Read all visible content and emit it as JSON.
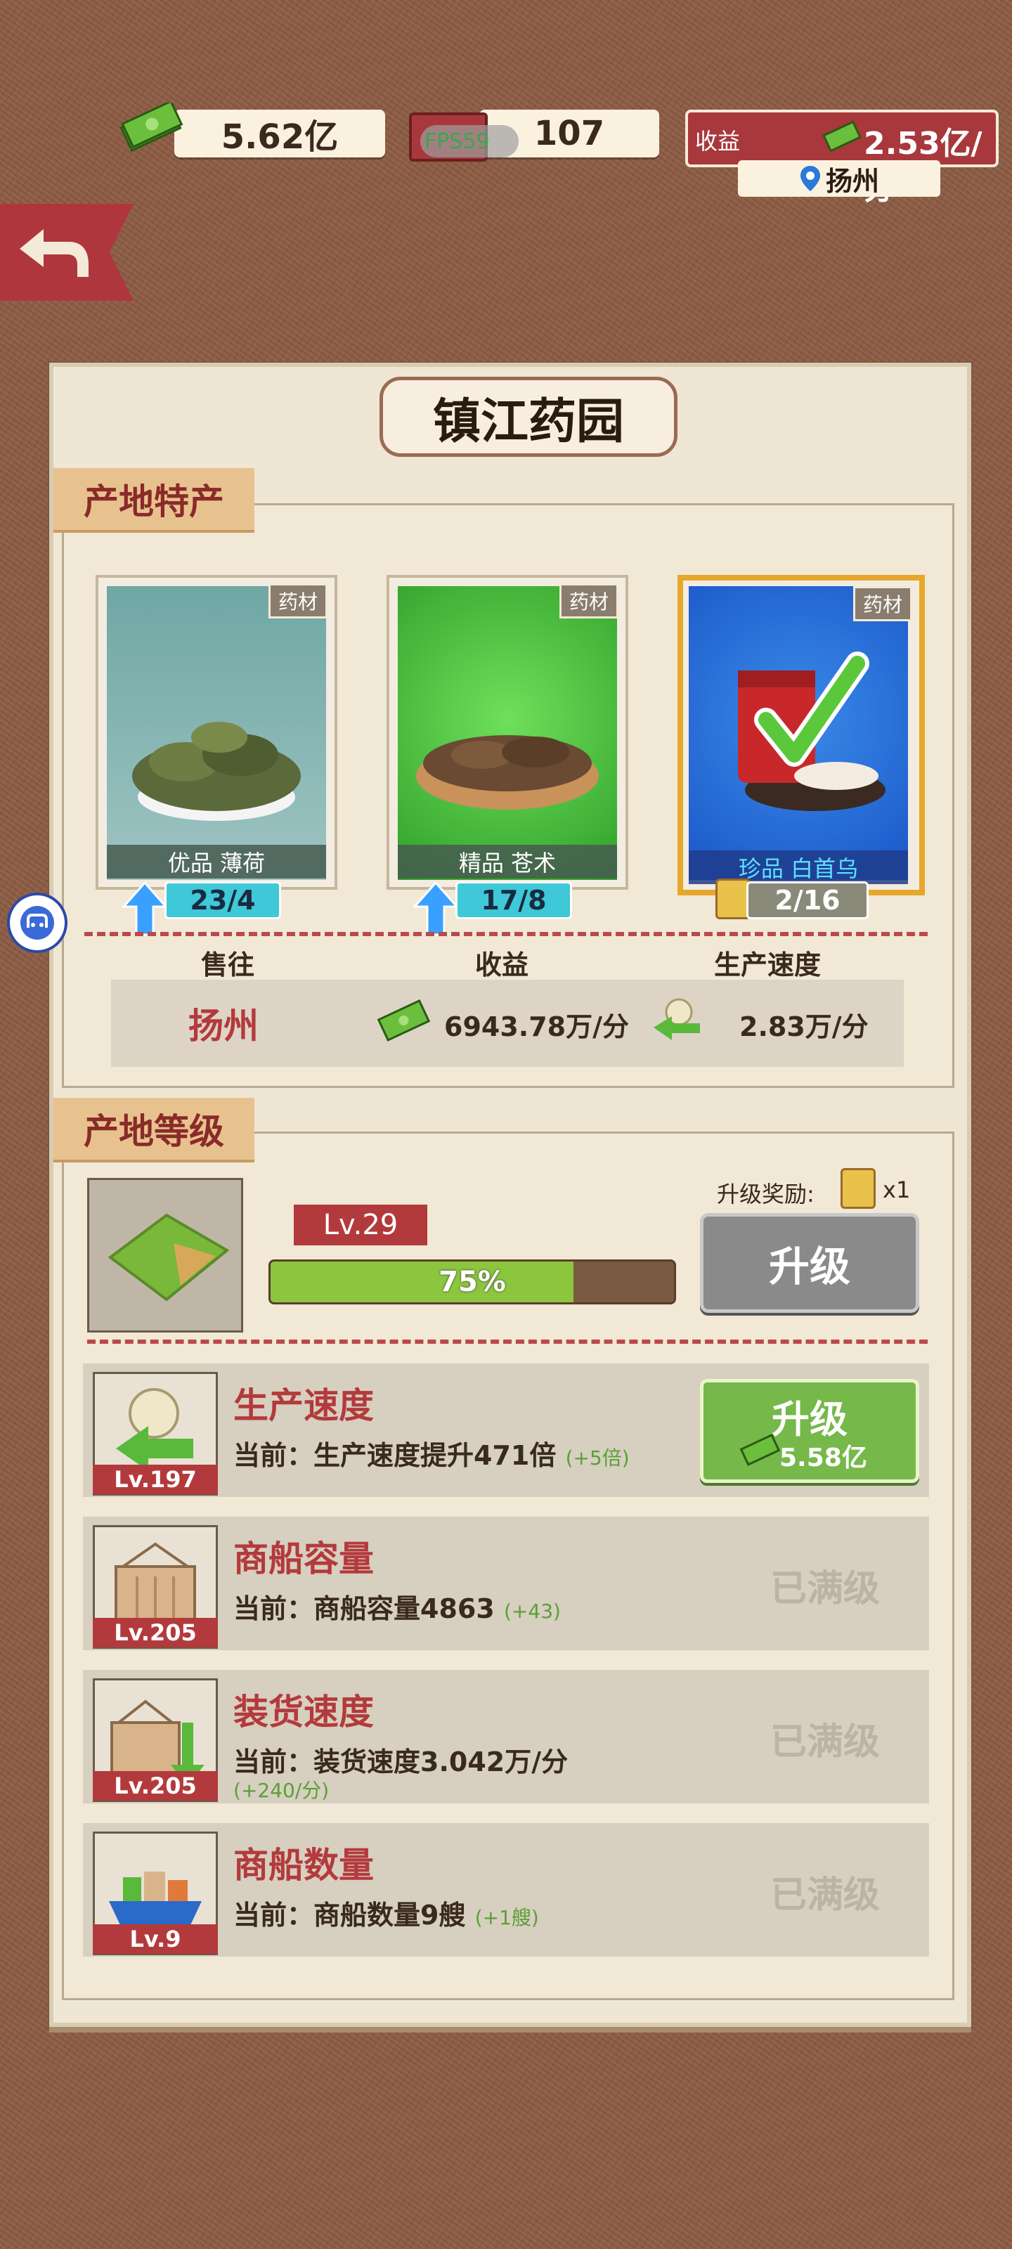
{
  "top": {
    "money": "5.62亿",
    "tickets": "107",
    "fps_overlay": "FPS59",
    "income_label": "收益",
    "income_value": "2.53亿/分",
    "location": "扬州"
  },
  "panel": {
    "title": "镇江药园",
    "specialty_tab": "产地特产",
    "level_tab": "产地等级"
  },
  "cards": [
    {
      "tag": "药材",
      "name": "优品  薄荷",
      "count": "23/4"
    },
    {
      "tag": "药材",
      "name": "精品  苍术",
      "count": "17/8"
    },
    {
      "tag": "药材",
      "name": "珍品  白首乌",
      "count": "2/16"
    }
  ],
  "info": {
    "head_sell": "售往",
    "head_income": "收益",
    "head_speed": "生产速度",
    "sell_to": "扬州",
    "income": "6943.78万/分",
    "speed": "2.83万/分"
  },
  "level": {
    "reward_label": "升级奖励:",
    "reward_count": "x1",
    "lv": "Lv.29",
    "progress_text": "75%",
    "progress_value": 0.75,
    "upgrade_label": "升级"
  },
  "rows": [
    {
      "title": "生产速度",
      "lv": "Lv.197",
      "desc": "当前：生产速度提升471倍",
      "bonus": "(+5倍)",
      "button_label": "升级",
      "button_cost": "5.58亿"
    },
    {
      "title": "商船容量",
      "lv": "Lv.205",
      "desc": "当前：商船容量4863",
      "bonus": "(+43)",
      "status": "已满级"
    },
    {
      "title": "装货速度",
      "lv": "Lv.205",
      "desc": "当前：装货速度3.042万/分",
      "bonus": "(+240/分)",
      "status": "已满级"
    },
    {
      "title": "商船数量",
      "lv": "Lv.9",
      "desc": "当前：商船数量9艘",
      "bonus": "(+1艘)",
      "status": "已满级"
    }
  ],
  "colors": {
    "background": "#8d5b42",
    "accent_red": "#b33a3c",
    "progress_green": "#8cc63f",
    "pill_cyan": "#3ec8d8",
    "gold_border": "#e6a72a"
  }
}
